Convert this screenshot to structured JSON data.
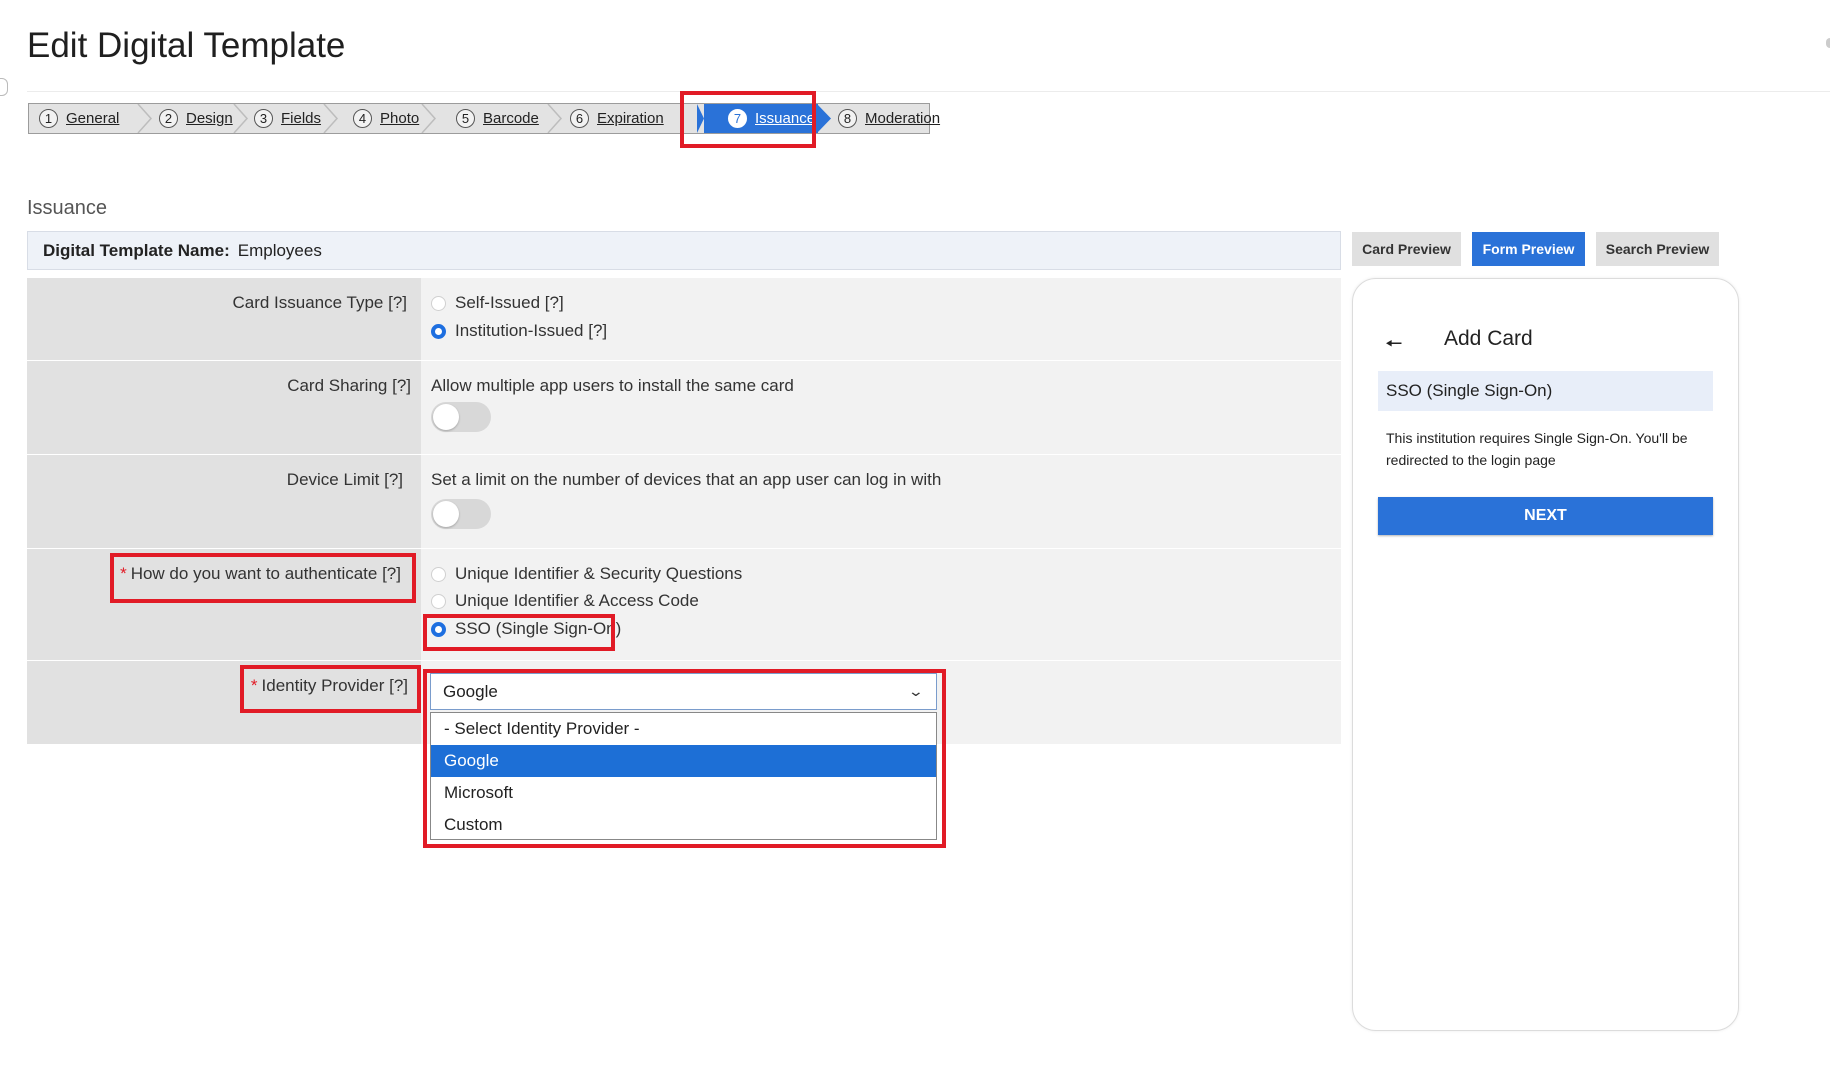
{
  "page": {
    "title": "Edit Digital Template"
  },
  "wizard": {
    "steps": [
      {
        "num": "1",
        "label": "General"
      },
      {
        "num": "2",
        "label": "Design"
      },
      {
        "num": "3",
        "label": "Fields"
      },
      {
        "num": "4",
        "label": "Photo"
      },
      {
        "num": "5",
        "label": "Barcode"
      },
      {
        "num": "6",
        "label": "Expiration"
      },
      {
        "num": "7",
        "label": "Issuance",
        "active": true
      },
      {
        "num": "8",
        "label": "Moderation"
      }
    ]
  },
  "section": {
    "label": "Issuance"
  },
  "template": {
    "name_key": "Digital Template Name:",
    "name_value": "Employees"
  },
  "form": {
    "issuance_type": {
      "label": "Card Issuance Type [?]",
      "options": [
        "Self-Issued [?]",
        "Institution-Issued [?]"
      ],
      "selected": "Institution-Issued [?]"
    },
    "card_sharing": {
      "label": "Card Sharing [?]",
      "description": "Allow multiple app users to install the same card",
      "enabled": false
    },
    "device_limit": {
      "label": "Device Limit [?]",
      "description": "Set a limit on the number of devices that an app user can log in with",
      "enabled": false
    },
    "auth": {
      "required_mark": "*",
      "label": "How do you want to authenticate [?]",
      "options": [
        "Unique Identifier & Security Questions",
        "Unique Identifier & Access Code",
        "SSO (Single Sign-On)"
      ],
      "selected": "SSO (Single Sign-On)"
    },
    "identity_provider": {
      "required_mark": "*",
      "label": "Identity Provider [?]",
      "value": "Google",
      "options": [
        "- Select Identity Provider -",
        "Google",
        "Microsoft",
        "Custom"
      ],
      "highlighted": "Google"
    }
  },
  "preview": {
    "tabs": [
      "Card Preview",
      "Form Preview",
      "Search Preview"
    ],
    "active_tab": "Form Preview",
    "phone": {
      "back_icon": "arrow-left-icon",
      "title": "Add Card",
      "method": "SSO (Single Sign-On)",
      "info": "This institution requires Single Sign-On. You'll be redirected to the login page",
      "next_label": "NEXT"
    }
  },
  "colors": {
    "accent": "#2a72d8",
    "highlight": "#e11b26",
    "required": "#e11b26"
  }
}
